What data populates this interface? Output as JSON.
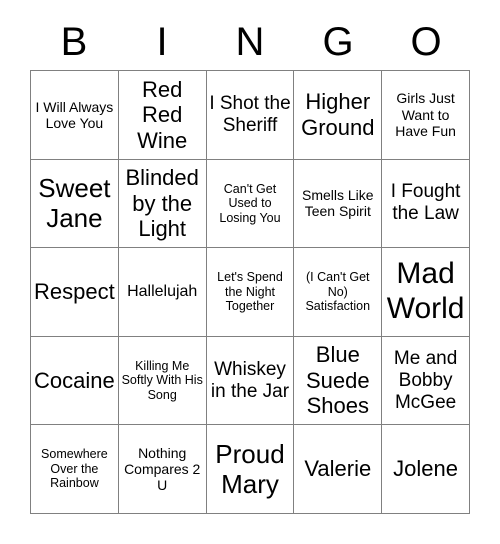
{
  "card": {
    "header_letters": [
      "B",
      "I",
      "N",
      "G",
      "O"
    ],
    "columns": 5,
    "rows": 5,
    "grid_line_color": "#808080",
    "text_color": "#000000",
    "background_color": "#ffffff",
    "cells": [
      [
        {
          "text": "I Will Always Love You",
          "size": "s"
        },
        {
          "text": "Red Red Wine",
          "size": "xl"
        },
        {
          "text": "I Shot the Sheriff",
          "size": "l"
        },
        {
          "text": "Higher Ground",
          "size": "xl"
        },
        {
          "text": "Girls Just Want to Have Fun",
          "size": "s"
        }
      ],
      [
        {
          "text": "Sweet Jane",
          "size": "xxl"
        },
        {
          "text": "Blinded by the Light",
          "size": "xl"
        },
        {
          "text": "Can't Get Used to Losing You",
          "size": "xs"
        },
        {
          "text": "Smells Like Teen Spirit",
          "size": "s"
        },
        {
          "text": "I Fought the Law",
          "size": "l"
        }
      ],
      [
        {
          "text": "Respect",
          "size": "xl"
        },
        {
          "text": "Hallelujah",
          "size": "m"
        },
        {
          "text": "Let's Spend the Night Together",
          "size": "xs"
        },
        {
          "text": "(I Can't Get No) Satisfaction",
          "size": "xs"
        },
        {
          "text": "Mad World",
          "size": "huge"
        }
      ],
      [
        {
          "text": "Cocaine",
          "size": "xl"
        },
        {
          "text": "Killing Me Softly With His Song",
          "size": "xs"
        },
        {
          "text": "Whiskey in the Jar",
          "size": "l"
        },
        {
          "text": "Blue Suede Shoes",
          "size": "xl"
        },
        {
          "text": "Me and Bobby McGee",
          "size": "l"
        }
      ],
      [
        {
          "text": "Somewhere Over the Rainbow",
          "size": "xs"
        },
        {
          "text": "Nothing Compares 2 U",
          "size": "s"
        },
        {
          "text": "Proud Mary",
          "size": "xxl"
        },
        {
          "text": "Valerie",
          "size": "xl"
        },
        {
          "text": "Jolene",
          "size": "xl"
        }
      ]
    ]
  }
}
